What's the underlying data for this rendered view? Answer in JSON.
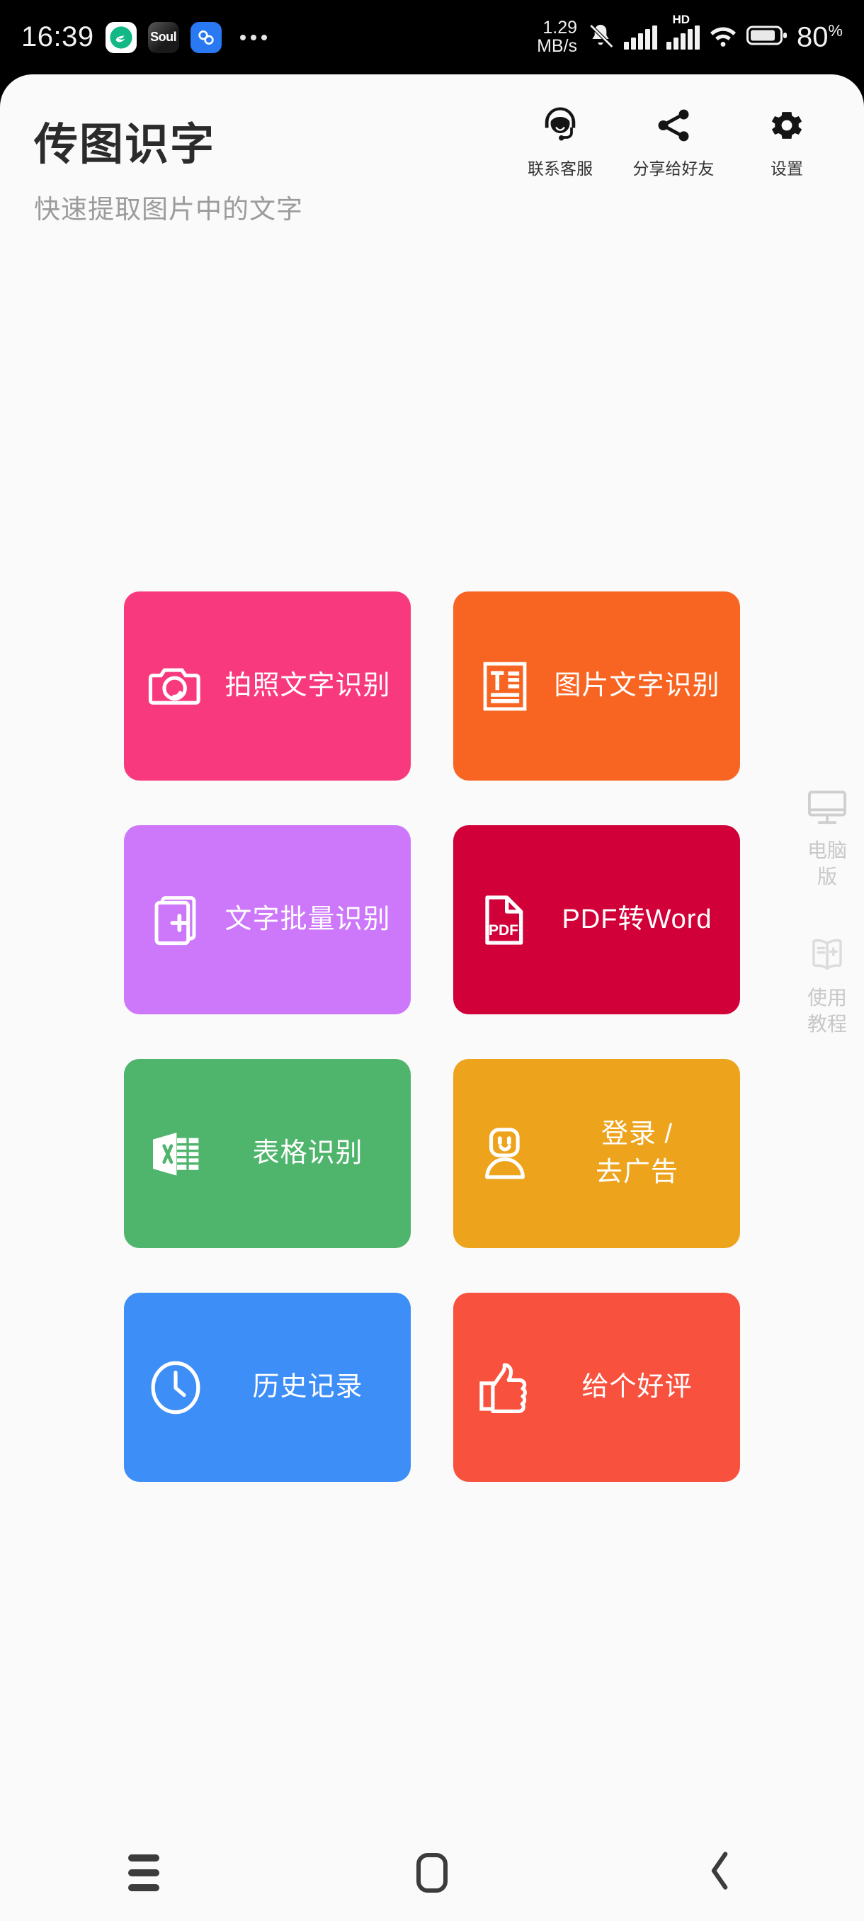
{
  "status_bar": {
    "time": "16:39",
    "notif_icons": [
      "app-icon-green-swirl",
      "app-icon-soul",
      "app-icon-blue-cloud"
    ],
    "soul_label": "Soul",
    "overflow": "•••",
    "net_speed_value": "1.29",
    "net_speed_unit": "MB/s",
    "mute_icon": "bell-muted-icon",
    "signal_1_icon": "signal-bars-icon",
    "signal_2_icon": "signal-bars-hd-icon",
    "hd_label": "HD",
    "wifi_icon": "wifi-icon",
    "battery_icon": "battery-icon",
    "battery_percent": "80",
    "battery_percent_symbol": "%"
  },
  "header": {
    "title": "传图识字",
    "subtitle": "快速提取图片中的文字",
    "actions": [
      {
        "label": "联系客服",
        "icon": "headset-support-icon"
      },
      {
        "label": "分享给好友",
        "icon": "share-icon"
      },
      {
        "label": "设置",
        "icon": "gear-icon"
      }
    ]
  },
  "grid": {
    "cards": [
      {
        "label": "拍照文字识别",
        "icon": "camera-icon",
        "color": "#f9397e"
      },
      {
        "label": "图片文字识别",
        "icon": "text-document-icon",
        "color": "#f86522"
      },
      {
        "label": "文字批量识别",
        "icon": "batch-pages-plus-icon",
        "color": "#cd77fb"
      },
      {
        "label": "PDF转Word",
        "icon": "pdf-file-icon",
        "color": "#d10039"
      },
      {
        "label": "表格识别",
        "icon": "excel-sheet-icon",
        "color": "#4fb46c"
      },
      {
        "label": "登录 /\n去广告",
        "icon": "user-smile-icon",
        "color": "#eda31c"
      },
      {
        "label": "历史记录",
        "icon": "clock-icon",
        "color": "#3d8ef7"
      },
      {
        "label": "给个好评",
        "icon": "thumbs-up-icon",
        "color": "#f8523f"
      }
    ]
  },
  "side_rail": {
    "items": [
      {
        "label": "电脑版",
        "icon": "monitor-icon"
      },
      {
        "label": "使用教程",
        "icon": "open-book-plus-icon"
      }
    ]
  },
  "nav_bar": {
    "recents": "recents-icon",
    "home": "home-icon",
    "back": "back-icon"
  },
  "colors": {
    "app_background": "#fafafa",
    "status_bar_background": "#000000",
    "title_text": "#2b2b2b",
    "subtitle_text": "#9b9b9b",
    "rail_text": "#c8c8c8"
  }
}
